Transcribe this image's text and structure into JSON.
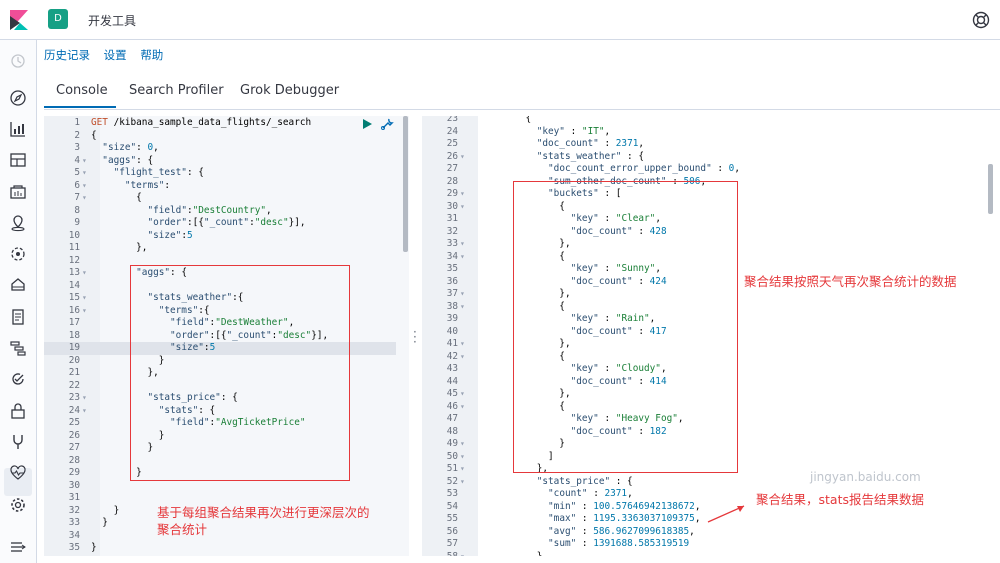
{
  "app": {
    "space_initial": "D",
    "title": "开发工具"
  },
  "menu": {
    "history": "历史记录",
    "settings": "设置",
    "help": "帮助"
  },
  "tabs": [
    "Console",
    "Search Profiler",
    "Grok Debugger"
  ],
  "request": {
    "lines": [
      {
        "n": "1",
        "fold": "",
        "t": "GET /kibana_sample_data_flights/_search"
      },
      {
        "n": "2",
        "fold": "",
        "t": "{"
      },
      {
        "n": "3",
        "fold": "",
        "t": "  \"size\": 0,"
      },
      {
        "n": "4",
        "fold": "▾",
        "t": "  \"aggs\": {"
      },
      {
        "n": "5",
        "fold": "▾",
        "t": "    \"flight_test\": {"
      },
      {
        "n": "6",
        "fold": "▾",
        "t": "      \"terms\":"
      },
      {
        "n": "7",
        "fold": "▾",
        "t": "        {"
      },
      {
        "n": "8",
        "fold": "",
        "t": "          \"field\":\"DestCountry\","
      },
      {
        "n": "9",
        "fold": "",
        "t": "          \"order\":[{\"_count\":\"desc\"}],"
      },
      {
        "n": "10",
        "fold": "",
        "t": "          \"size\":5"
      },
      {
        "n": "11",
        "fold": "",
        "t": "        },"
      },
      {
        "n": "12",
        "fold": "",
        "t": ""
      },
      {
        "n": "13",
        "fold": "▾",
        "t": "        \"aggs\": {"
      },
      {
        "n": "14",
        "fold": "",
        "t": ""
      },
      {
        "n": "15",
        "fold": "▾",
        "t": "          \"stats_weather\":{"
      },
      {
        "n": "16",
        "fold": "▾",
        "t": "            \"terms\":{"
      },
      {
        "n": "17",
        "fold": "",
        "t": "              \"field\":\"DestWeather\","
      },
      {
        "n": "18",
        "fold": "",
        "t": "              \"order\":[{\"_count\":\"desc\"}],"
      },
      {
        "n": "19",
        "fold": "",
        "t": "              \"size\":5"
      },
      {
        "n": "20",
        "fold": "",
        "t": "            }"
      },
      {
        "n": "21",
        "fold": "",
        "t": "          },"
      },
      {
        "n": "22",
        "fold": "",
        "t": ""
      },
      {
        "n": "23",
        "fold": "▾",
        "t": "          \"stats_price\": {"
      },
      {
        "n": "24",
        "fold": "▾",
        "t": "            \"stats\": {"
      },
      {
        "n": "25",
        "fold": "",
        "t": "              \"field\":\"AvgTicketPrice\""
      },
      {
        "n": "26",
        "fold": "",
        "t": "            }"
      },
      {
        "n": "27",
        "fold": "",
        "t": "          }"
      },
      {
        "n": "28",
        "fold": "",
        "t": ""
      },
      {
        "n": "29",
        "fold": "",
        "t": "        }"
      },
      {
        "n": "30",
        "fold": "",
        "t": ""
      },
      {
        "n": "31",
        "fold": "",
        "t": ""
      },
      {
        "n": "32",
        "fold": "",
        "t": "    }"
      },
      {
        "n": "33",
        "fold": "",
        "t": "  }"
      },
      {
        "n": "34",
        "fold": "",
        "t": ""
      },
      {
        "n": "35",
        "fold": "",
        "t": "}"
      }
    ]
  },
  "response": {
    "lines": [
      {
        "n": "23",
        "fold": "",
        "t": "          {"
      },
      {
        "n": "24",
        "fold": "",
        "t": "            \"key\" : \"IT\","
      },
      {
        "n": "25",
        "fold": "",
        "t": "            \"doc_count\" : 2371,"
      },
      {
        "n": "26",
        "fold": "▾",
        "t": "            \"stats_weather\" : {"
      },
      {
        "n": "27",
        "fold": "",
        "t": "              \"doc_count_error_upper_bound\" : 0,"
      },
      {
        "n": "28",
        "fold": "",
        "t": "              \"sum_other_doc_count\" : 506,"
      },
      {
        "n": "29",
        "fold": "▾",
        "t": "              \"buckets\" : ["
      },
      {
        "n": "30",
        "fold": "▾",
        "t": "                {"
      },
      {
        "n": "31",
        "fold": "",
        "t": "                  \"key\" : \"Clear\","
      },
      {
        "n": "32",
        "fold": "",
        "t": "                  \"doc_count\" : 428"
      },
      {
        "n": "33",
        "fold": "▾",
        "t": "                },"
      },
      {
        "n": "34",
        "fold": "▾",
        "t": "                {"
      },
      {
        "n": "35",
        "fold": "",
        "t": "                  \"key\" : \"Sunny\","
      },
      {
        "n": "36",
        "fold": "",
        "t": "                  \"doc_count\" : 424"
      },
      {
        "n": "37",
        "fold": "▾",
        "t": "                },"
      },
      {
        "n": "38",
        "fold": "▾",
        "t": "                {"
      },
      {
        "n": "39",
        "fold": "",
        "t": "                  \"key\" : \"Rain\","
      },
      {
        "n": "40",
        "fold": "",
        "t": "                  \"doc_count\" : 417"
      },
      {
        "n": "41",
        "fold": "▾",
        "t": "                },"
      },
      {
        "n": "42",
        "fold": "▾",
        "t": "                {"
      },
      {
        "n": "43",
        "fold": "",
        "t": "                  \"key\" : \"Cloudy\","
      },
      {
        "n": "44",
        "fold": "",
        "t": "                  \"doc_count\" : 414"
      },
      {
        "n": "45",
        "fold": "▾",
        "t": "                },"
      },
      {
        "n": "46",
        "fold": "▾",
        "t": "                {"
      },
      {
        "n": "47",
        "fold": "",
        "t": "                  \"key\" : \"Heavy Fog\","
      },
      {
        "n": "48",
        "fold": "",
        "t": "                  \"doc_count\" : 182"
      },
      {
        "n": "49",
        "fold": "▾",
        "t": "                }"
      },
      {
        "n": "50",
        "fold": "▾",
        "t": "              ]"
      },
      {
        "n": "51",
        "fold": "▾",
        "t": "            },"
      },
      {
        "n": "52",
        "fold": "▾",
        "t": "            \"stats_price\" : {"
      },
      {
        "n": "53",
        "fold": "",
        "t": "              \"count\" : 2371,"
      },
      {
        "n": "54",
        "fold": "",
        "t": "              \"min\" : 100.57646942138672,"
      },
      {
        "n": "55",
        "fold": "",
        "t": "              \"max\" : 1195.3363037109375,"
      },
      {
        "n": "56",
        "fold": "",
        "t": "              \"avg\" : 586.9627099618385,"
      },
      {
        "n": "57",
        "fold": "",
        "t": "              \"sum\" : 1391688.585319519"
      },
      {
        "n": "58",
        "fold": "▾",
        "t": "            }"
      }
    ]
  },
  "annotations": {
    "left_note": "基于每组聚合结果再次进行更深层次的\n聚合统计",
    "right_note": "聚合结果按照天气再次聚合统计的数据",
    "price_note": "聚合结果，stats报告结果数据",
    "watermark": "jingyan.baidu.com"
  },
  "colors": {
    "annotation": "#e5383b",
    "link": "#006bb4",
    "space_badge": "#16a085"
  }
}
